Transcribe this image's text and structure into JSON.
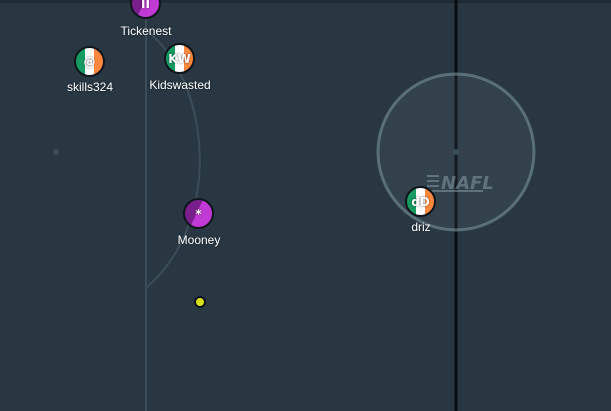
{
  "game": {
    "watermark": "NAFL",
    "colors": {
      "field": "#283742",
      "line": "#3b4d59",
      "center_line": "#0a0d10",
      "ball": "#d9e01c"
    },
    "players": [
      {
        "name": "Tickenest",
        "avatar": "II",
        "flag": "purple"
      },
      {
        "name": "skills324",
        "avatar": "@",
        "flag": "ireland"
      },
      {
        "name": "Kidswasted",
        "avatar": "KW",
        "flag": "ireland"
      },
      {
        "name": "Mooney",
        "avatar": "*",
        "flag": "purple"
      },
      {
        "name": "driz",
        "avatar": "dD",
        "flag": "ireland"
      }
    ]
  }
}
